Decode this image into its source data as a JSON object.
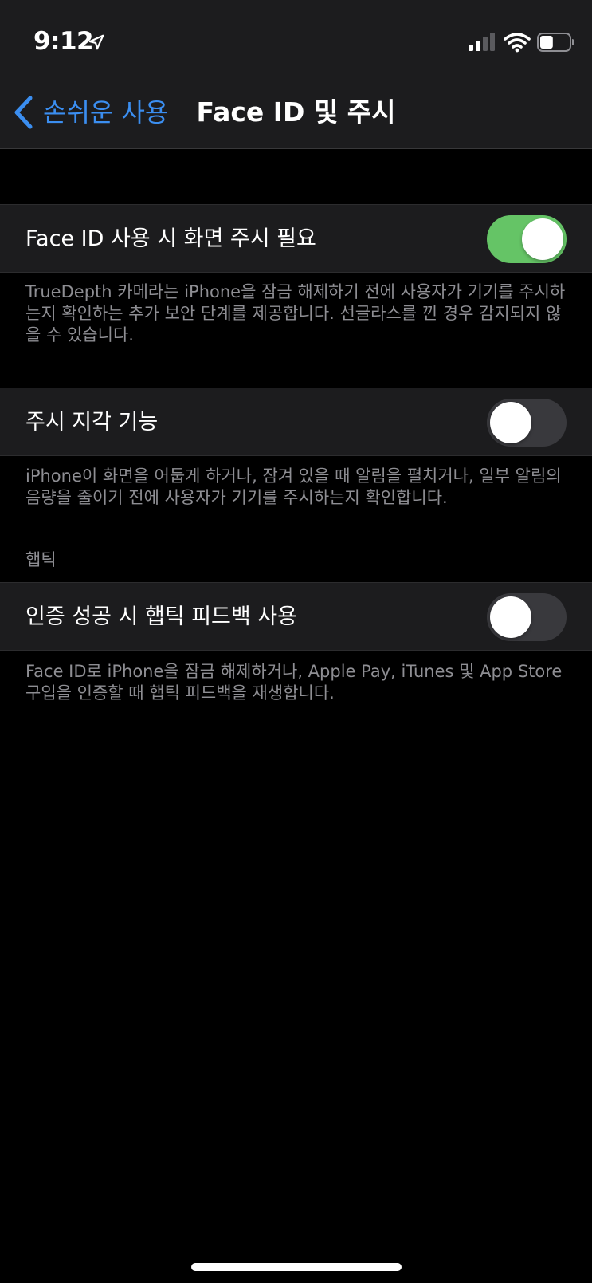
{
  "status_bar": {
    "time": "9:12",
    "location_icon": "location-arrow-icon",
    "signal_icon": "cellular-signal-icon",
    "wifi_icon": "wifi-icon",
    "battery_icon": "battery-icon",
    "battery_level": 0.45
  },
  "nav": {
    "back_label": "손쉬운 사용",
    "title": "Face ID 및 주시",
    "accent_color": "#3b8ef0"
  },
  "settings": {
    "attention_required": {
      "label": "Face ID 사용 시 화면 주시 필요",
      "on": true,
      "footer": "TrueDepth 카메라는 iPhone을 잠금 해제하기 전에 사용자가 기기를 주시하는지 확인하는 추가 보안 단계를 제공합니다. 선글라스를 낀 경우 감지되지 않을 수 있습니다."
    },
    "attention_aware": {
      "label": "주시 지각 기능",
      "on": false,
      "footer": "iPhone이 화면을 어둡게 하거나, 잠겨 있을 때 알림을 펼치거나, 일부 알림의 음량을 줄이기 전에 사용자가 기기를 주시하는지 확인합니다."
    },
    "haptics_section_header": "햅틱",
    "haptic_feedback": {
      "label": "인증 성공 시 햅틱 피드백 사용",
      "on": false,
      "footer": "Face ID로 iPhone을 잠금 해제하거나, Apple Pay, iTunes 및 App Store 구입을 인증할 때 햅틱 피드백을 재생합니다."
    }
  },
  "colors": {
    "toggle_on": "#65c466",
    "toggle_off": "#39393d",
    "cell_background": "#1c1c1e",
    "footer_text": "#8e8e93"
  }
}
